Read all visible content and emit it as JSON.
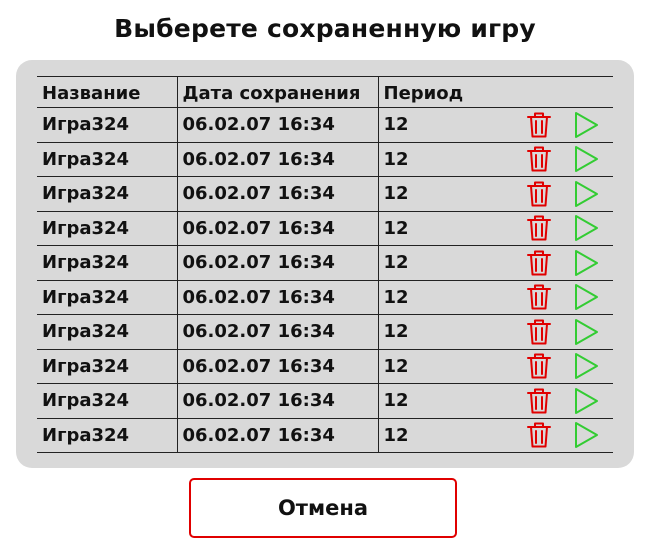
{
  "header": {
    "title": "Выберете сохраненную игру"
  },
  "table": {
    "columns": [
      "Название",
      "Дата сохранения",
      "Период"
    ],
    "rows": [
      {
        "name": "Игра324",
        "date": "06.02.07 16:34",
        "period": "12"
      },
      {
        "name": "Игра324",
        "date": "06.02.07 16:34",
        "period": "12"
      },
      {
        "name": "Игра324",
        "date": "06.02.07 16:34",
        "period": "12"
      },
      {
        "name": "Игра324",
        "date": "06.02.07 16:34",
        "period": "12"
      },
      {
        "name": "Игра324",
        "date": "06.02.07 16:34",
        "period": "12"
      },
      {
        "name": "Игра324",
        "date": "06.02.07 16:34",
        "period": "12"
      },
      {
        "name": "Игра324",
        "date": "06.02.07 16:34",
        "period": "12"
      },
      {
        "name": "Игра324",
        "date": "06.02.07 16:34",
        "period": "12"
      },
      {
        "name": "Игра324",
        "date": "06.02.07 16:34",
        "period": "12"
      },
      {
        "name": "Игра324",
        "date": "06.02.07 16:34",
        "period": "12"
      }
    ],
    "row_actions": {
      "delete_icon": "trash-icon",
      "load_icon": "play-icon"
    }
  },
  "footer": {
    "cancel_label": "Отмена"
  },
  "colors": {
    "panel_background": "#d9d9d9",
    "delete_icon": "#e00000",
    "play_icon": "#33cc33",
    "cancel_border": "#e00000"
  }
}
